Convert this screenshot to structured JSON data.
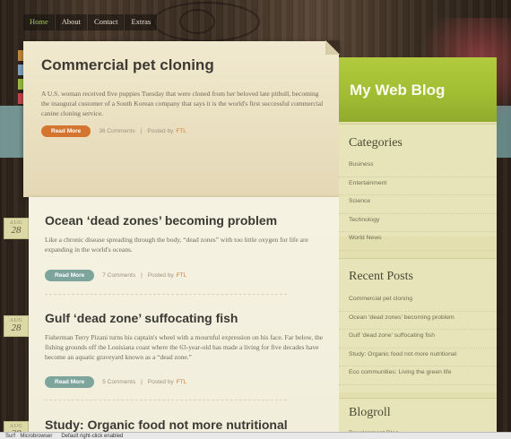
{
  "nav": {
    "items": [
      "Home",
      "About",
      "Contact",
      "Extras"
    ]
  },
  "featured": {
    "title": "Commercial pet cloning",
    "excerpt": "A U.S. woman received five puppies Tuesday that were cloned from her beloved late pitbull, becoming the inaugural customer of a South Korean company that says it is the world's first successful commercial canine cloning service.",
    "read_more": "Read More",
    "comments": "36 Comments",
    "posted_by": "Posted by",
    "author": "FTL"
  },
  "posts": [
    {
      "title": "Ocean ‘dead zones’ becoming problem",
      "excerpt": "Like a chronic disease spreading through the body, “dead zones” with too little oxygen for life are expanding in the world's oceans.",
      "read_more": "Read More",
      "comments": "7 Comments",
      "posted_by": "Posted by",
      "author": "FTL",
      "date_month": "AUG",
      "date_day": "28"
    },
    {
      "title": "Gulf ‘dead zone’ suffocating fish",
      "excerpt": "Fisherman Terry Pizani turns his captain's wheel with a mournful expression on his face. Far below, the fishing grounds off the Louisiana coast where the 63-year-old has made a living for five decades have become an aquatic graveyard known as a “dead zone.”",
      "read_more": "Read More",
      "comments": "5 Comments",
      "posted_by": "Posted by",
      "author": "FTL",
      "date_month": "AUG",
      "date_day": "28"
    },
    {
      "title": "Study: Organic food not more nutritional",
      "date_month": "AUG",
      "date_day": "28"
    }
  ],
  "sidebar": {
    "blog_title": "My Web Blog",
    "categories_title": "Categories",
    "categories": [
      "Business",
      "Entertainment",
      "Science",
      "Technology",
      "World News"
    ],
    "recent_title": "Recent Posts",
    "recent": [
      "Commercial pet cloning",
      "Ocean ‘dead zones’ becoming problem",
      "Gulf ‘dead zone’ suffocating fish",
      "Study: Organic food not more nutritional",
      "Eco communities: Living the green life"
    ],
    "blogroll_title": "Blogroll",
    "blogroll": [
      "Development Blog"
    ]
  },
  "statusbar": {
    "items": [
      "Surf · Microbrowser",
      "Default right-click enabled"
    ]
  },
  "colors": {
    "accent_green": "#a6c640",
    "read_more_orange": "#d4752f",
    "read_more_teal": "#7ea59c",
    "author_orange": "#d07b3a"
  }
}
